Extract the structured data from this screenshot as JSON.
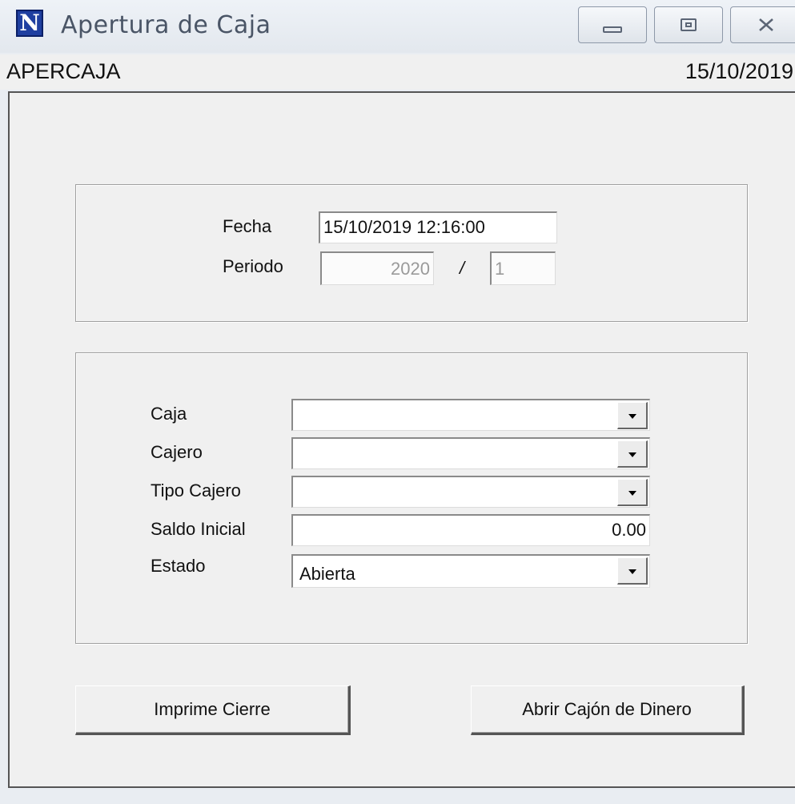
{
  "window": {
    "title": "Apertura de Caja",
    "icon_letter": "N",
    "controls": {
      "minimize": "minimize-icon",
      "maximize": "maximize-icon",
      "close": "close-icon"
    }
  },
  "header": {
    "form_code": "APERCAJA",
    "date": "15/10/2019"
  },
  "period_group": {
    "fecha_label": "Fecha",
    "fecha_value": "15/10/2019 12:16:00",
    "periodo_label": "Periodo",
    "periodo_year": "2020",
    "separator": "/",
    "periodo_number": "1"
  },
  "cash_group": {
    "caja_label": "Caja",
    "caja_value": "",
    "cajero_label": "Cajero",
    "cajero_value": "",
    "tipo_cajero_label": "Tipo Cajero",
    "tipo_cajero_value": "",
    "saldo_inicial_label": "Saldo Inicial",
    "saldo_inicial_value": "0.00",
    "estado_label": "Estado",
    "estado_value": "Abierta"
  },
  "buttons": {
    "imprime_cierre": "Imprime Cierre",
    "abrir_cajon": "Abrir Cajón de Dinero"
  },
  "colors": {
    "app_icon_bg": "#1f3fa0",
    "window_bg": "#f0f0f0"
  }
}
